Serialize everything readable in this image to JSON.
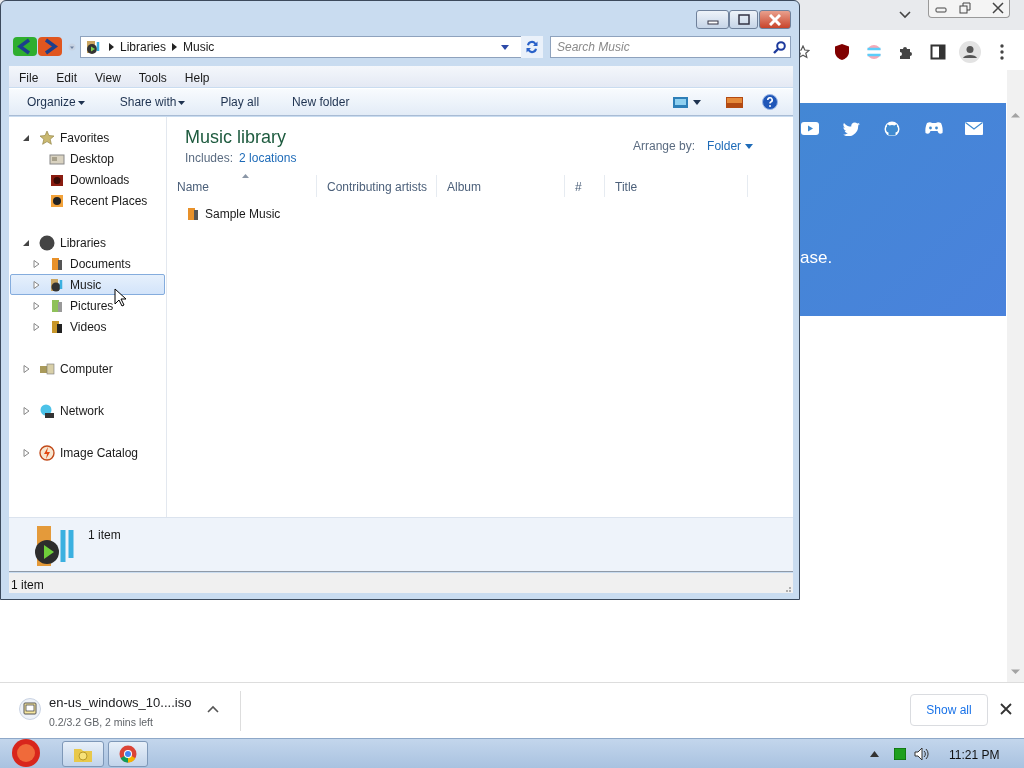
{
  "browser": {
    "banner": {
      "text": "ase."
    },
    "download_bar": {
      "file_name": "en-us_windows_10....iso",
      "progress": "0.2/3.2 GB, 2 mins left",
      "show_all": "Show all"
    }
  },
  "explorer": {
    "breadcrumb": [
      "Libraries",
      "Music"
    ],
    "search": {
      "placeholder": "Search Music"
    },
    "menu": [
      "File",
      "Edit",
      "View",
      "Tools",
      "Help"
    ],
    "toolbar": [
      {
        "label": "Organize",
        "dropdown": true
      },
      {
        "label": "Share with",
        "dropdown": true
      },
      {
        "label": "Play all",
        "dropdown": false
      },
      {
        "label": "New folder",
        "dropdown": false
      }
    ],
    "nav": [
      {
        "label": "Favorites",
        "expanded": true,
        "selected": false,
        "children": [
          {
            "label": "Desktop",
            "selected": false
          },
          {
            "label": "Downloads",
            "selected": false
          },
          {
            "label": "Recent Places",
            "selected": false
          }
        ]
      },
      {
        "label": "Libraries",
        "expanded": true,
        "selected": false,
        "children": [
          {
            "label": "Documents",
            "expanded": false,
            "selected": false
          },
          {
            "label": "Music",
            "expanded": false,
            "selected": true
          },
          {
            "label": "Pictures",
            "expanded": false,
            "selected": false
          },
          {
            "label": "Videos",
            "expanded": false,
            "selected": false
          }
        ]
      },
      {
        "label": "Computer",
        "expanded": false,
        "selected": false
      },
      {
        "label": "Network",
        "expanded": false,
        "selected": false
      },
      {
        "label": "Image Catalog",
        "expanded": false,
        "selected": false
      }
    ],
    "library": {
      "title": "Music library",
      "includes_label": "Includes:",
      "includes_link": "2 locations",
      "arrange_label": "Arrange by:",
      "arrange_value": "Folder"
    },
    "columns": [
      {
        "label": "Name",
        "sorted": true
      },
      {
        "label": "Contributing artists",
        "sorted": false
      },
      {
        "label": "Album",
        "sorted": false
      },
      {
        "label": "#",
        "sorted": false
      },
      {
        "label": "Title",
        "sorted": false
      }
    ],
    "files": [
      {
        "name": "Sample Music"
      }
    ],
    "details": {
      "count": "1 item"
    },
    "status_bar": "1 item"
  },
  "taskbar": {
    "clock": "11:21 PM"
  }
}
